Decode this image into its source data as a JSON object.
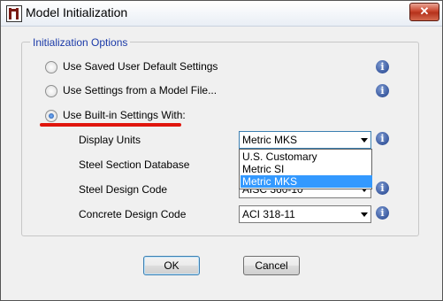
{
  "window": {
    "title": "Model Initialization",
    "close_glyph": "✕"
  },
  "group": {
    "title": "Initialization Options"
  },
  "options": [
    {
      "label": "Use Saved User Default Settings",
      "checked": false
    },
    {
      "label": "Use Settings from a Model File...",
      "checked": false
    },
    {
      "label": "Use Built-in Settings With:",
      "checked": true
    }
  ],
  "fields": {
    "display_units": {
      "label": "Display Units",
      "value": "Metric MKS"
    },
    "steel_section_database": {
      "label": "Steel Section Database",
      "value": ""
    },
    "steel_design_code": {
      "label": "Steel Design Code",
      "value": "AISC 360-10"
    },
    "concrete_design_code": {
      "label": "Concrete Design Code",
      "value": "ACI 318-11"
    }
  },
  "display_units_dropdown": {
    "open": true,
    "options": [
      "U.S. Customary",
      "Metric SI",
      "Metric MKS"
    ],
    "selected_index": 2
  },
  "buttons": {
    "ok": "OK",
    "cancel": "Cancel"
  },
  "icons": {
    "info_glyph": "i"
  },
  "colors": {
    "annotation_underline": "#e0150d",
    "selection": "#3399ff",
    "group_title": "#1b3aa8"
  }
}
